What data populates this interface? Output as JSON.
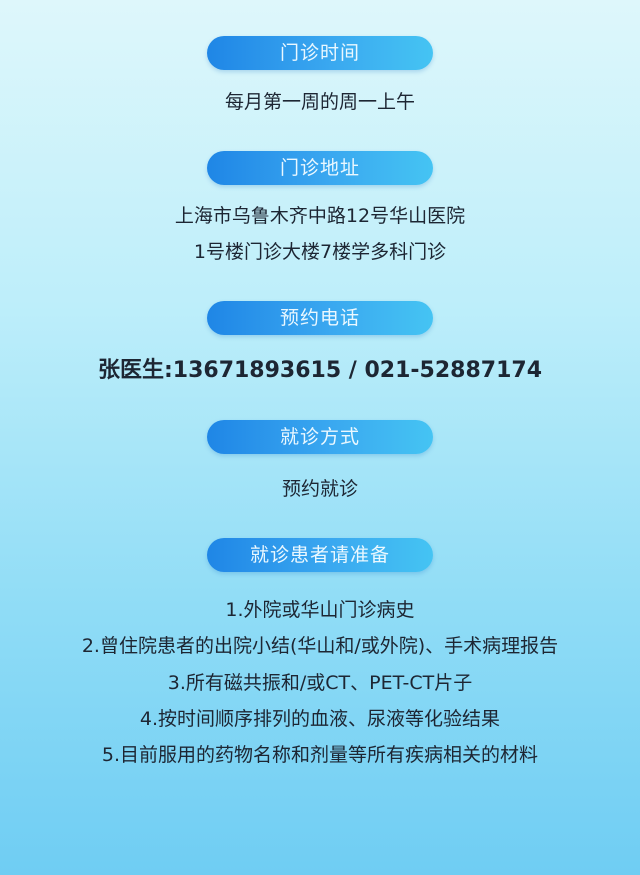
{
  "sections": [
    {
      "title": "门诊时间",
      "lines": [
        "每月第一周的周一上午"
      ]
    },
    {
      "title": "门诊地址",
      "lines": [
        "上海市乌鲁木齐中路12号华山医院",
        "1号楼门诊大楼7楼学多科门诊"
      ]
    },
    {
      "title": "预约电话",
      "lines": [
        "张医生:13671893615 / 021-52887174"
      ]
    },
    {
      "title": "就诊方式",
      "lines": [
        "预约就诊"
      ]
    },
    {
      "title": "就诊患者请准备",
      "lines": [
        "1.外院或华山门诊病史",
        "2.曾住院患者的出院小结(华山和/或外院)、手术病理报告",
        "3.所有磁共振和/或CT、PET-CT片子",
        "4.按时间顺序排列的血液、尿液等化验结果",
        "5.目前服用的药物名称和剂量等所有疾病相关的材料"
      ]
    }
  ]
}
